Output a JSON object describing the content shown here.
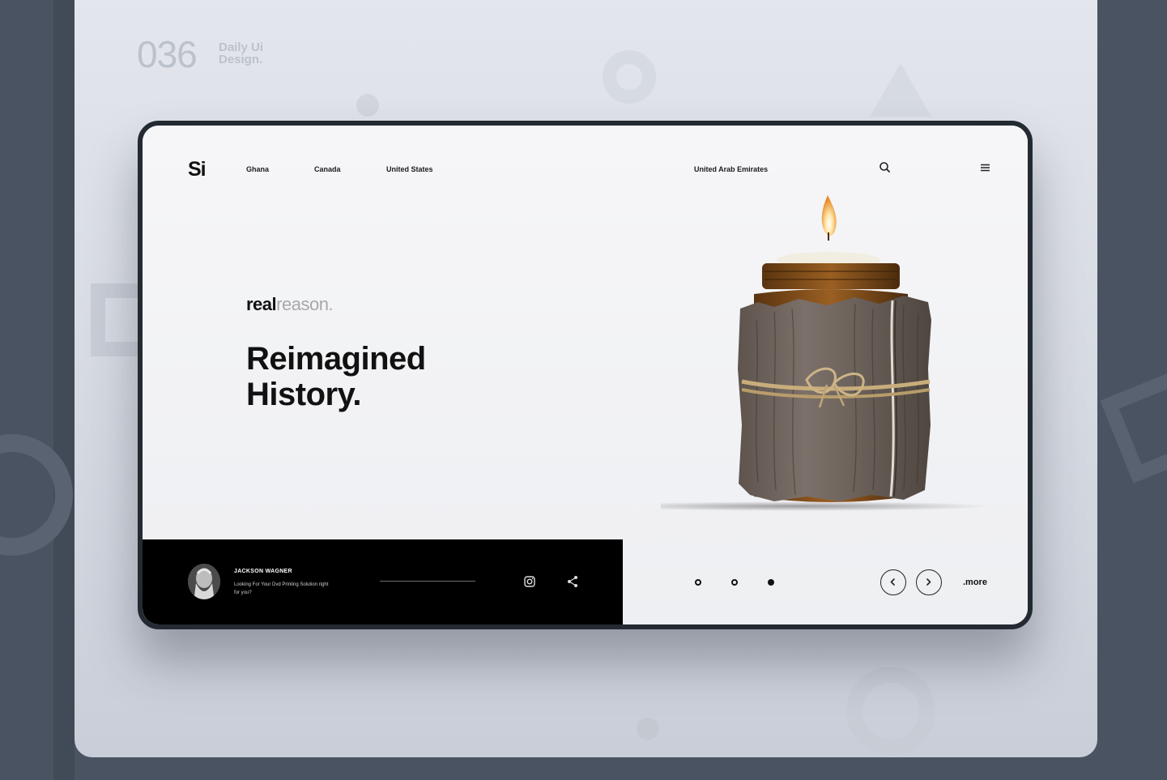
{
  "showcase": {
    "counter": "036",
    "subtitle_line1": "Daily Ui",
    "subtitle_line2": "Design."
  },
  "header": {
    "logo": "Si",
    "nav": [
      "Ghana",
      "Canada",
      "United States",
      "United Arab Emirates"
    ],
    "search_icon": "search-icon",
    "menu_icon": "hamburger-menu-icon"
  },
  "hero": {
    "tagline_bold": "real",
    "tagline_light": "reason.",
    "headline_line1": "Reimagined",
    "headline_line2": "History."
  },
  "author": {
    "name": "JACKSON WAGNER",
    "description": "Looking For Your Dvd Printing Solution right for you?",
    "social_icons": [
      "instagram-icon",
      "share-icon"
    ]
  },
  "carousel": {
    "pages": 3,
    "active_page": 3,
    "prev_icon": "chevron-left-icon",
    "next_icon": "chevron-right-icon",
    "more_label": ".more"
  },
  "colors": {
    "outer_background": "#4a5361",
    "card_background": "#e3e6ec",
    "screen_frame": "#232a32",
    "text_primary": "#111111",
    "tagline_muted": "#a8a8a8",
    "author_bar": "#000000"
  }
}
